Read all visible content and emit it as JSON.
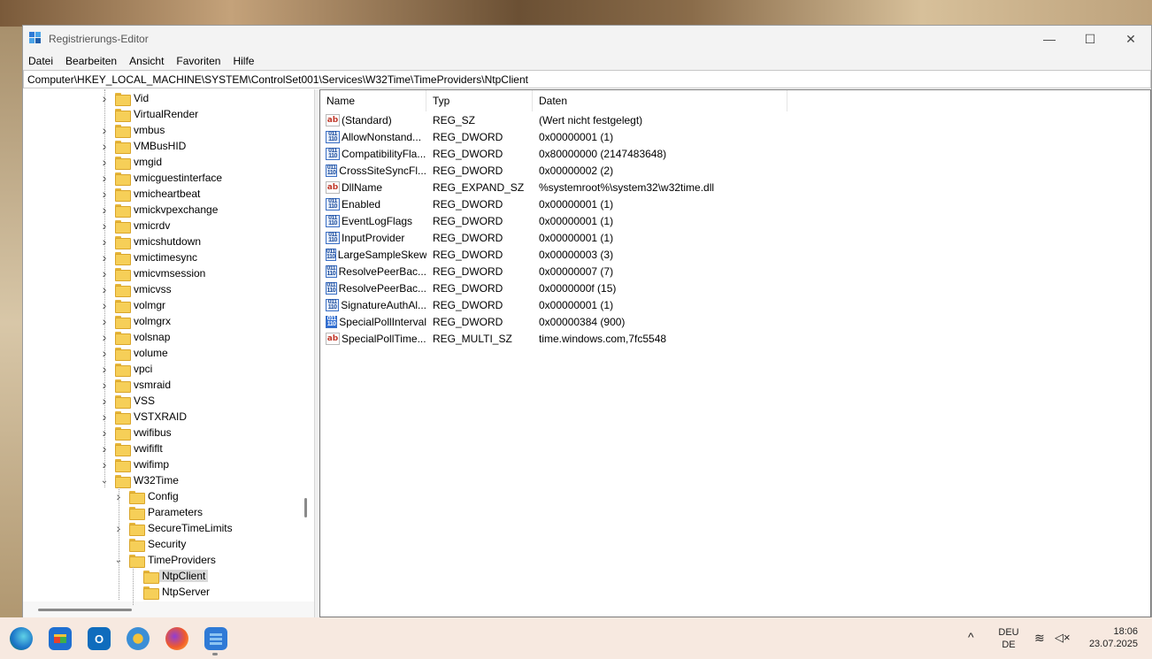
{
  "window": {
    "title": "Registrierungs-Editor",
    "controls": {
      "minimize": "—",
      "maximize": "☐",
      "close": "✕"
    }
  },
  "menu": [
    "Datei",
    "Bearbeiten",
    "Ansicht",
    "Favoriten",
    "Hilfe"
  ],
  "address": "Computer\\HKEY_LOCAL_MACHINE\\SYSTEM\\ControlSet001\\Services\\W32Time\\TimeProviders\\NtpClient",
  "tree": [
    {
      "label": "Vid",
      "expandable": true,
      "level": 0
    },
    {
      "label": "VirtualRender",
      "expandable": false,
      "level": 0
    },
    {
      "label": "vmbus",
      "expandable": true,
      "level": 0
    },
    {
      "label": "VMBusHID",
      "expandable": true,
      "level": 0
    },
    {
      "label": "vmgid",
      "expandable": true,
      "level": 0
    },
    {
      "label": "vmicguestinterface",
      "expandable": true,
      "level": 0
    },
    {
      "label": "vmicheartbeat",
      "expandable": true,
      "level": 0
    },
    {
      "label": "vmickvpexchange",
      "expandable": true,
      "level": 0
    },
    {
      "label": "vmicrdv",
      "expandable": true,
      "level": 0
    },
    {
      "label": "vmicshutdown",
      "expandable": true,
      "level": 0
    },
    {
      "label": "vmictimesync",
      "expandable": true,
      "level": 0
    },
    {
      "label": "vmicvmsession",
      "expandable": true,
      "level": 0
    },
    {
      "label": "vmicvss",
      "expandable": true,
      "level": 0
    },
    {
      "label": "volmgr",
      "expandable": true,
      "level": 0
    },
    {
      "label": "volmgrx",
      "expandable": true,
      "level": 0
    },
    {
      "label": "volsnap",
      "expandable": true,
      "level": 0
    },
    {
      "label": "volume",
      "expandable": true,
      "level": 0
    },
    {
      "label": "vpci",
      "expandable": true,
      "level": 0
    },
    {
      "label": "vsmraid",
      "expandable": true,
      "level": 0
    },
    {
      "label": "VSS",
      "expandable": true,
      "level": 0
    },
    {
      "label": "VSTXRAID",
      "expandable": true,
      "level": 0
    },
    {
      "label": "vwifibus",
      "expandable": true,
      "level": 0
    },
    {
      "label": "vwififlt",
      "expandable": true,
      "level": 0
    },
    {
      "label": "vwifimp",
      "expandable": true,
      "level": 0
    },
    {
      "label": "W32Time",
      "expandable": true,
      "expanded": true,
      "level": 0
    },
    {
      "label": "Config",
      "expandable": true,
      "level": 1
    },
    {
      "label": "Parameters",
      "expandable": false,
      "level": 1
    },
    {
      "label": "SecureTimeLimits",
      "expandable": true,
      "level": 1
    },
    {
      "label": "Security",
      "expandable": false,
      "level": 1
    },
    {
      "label": "TimeProviders",
      "expandable": true,
      "expanded": true,
      "level": 1
    },
    {
      "label": "NtpClient",
      "expandable": false,
      "level": 2,
      "selected": true
    },
    {
      "label": "NtpServer",
      "expandable": false,
      "level": 2
    }
  ],
  "list": {
    "columns": [
      "Name",
      "Typ",
      "Daten"
    ],
    "rows": [
      {
        "icon": "string-value-icon",
        "name": "(Standard)",
        "type": "REG_SZ",
        "data": "(Wert nicht festgelegt)"
      },
      {
        "icon": "binary-value-icon",
        "name": "AllowNonstand...",
        "type": "REG_DWORD",
        "data": "0x00000001 (1)"
      },
      {
        "icon": "binary-value-icon",
        "name": "CompatibilityFla...",
        "type": "REG_DWORD",
        "data": "0x80000000 (2147483648)"
      },
      {
        "icon": "binary-value-icon",
        "name": "CrossSiteSyncFl...",
        "type": "REG_DWORD",
        "data": "0x00000002 (2)"
      },
      {
        "icon": "string-value-icon",
        "name": "DllName",
        "type": "REG_EXPAND_SZ",
        "data": "%systemroot%\\system32\\w32time.dll"
      },
      {
        "icon": "binary-value-icon",
        "name": "Enabled",
        "type": "REG_DWORD",
        "data": "0x00000001 (1)"
      },
      {
        "icon": "binary-value-icon",
        "name": "EventLogFlags",
        "type": "REG_DWORD",
        "data": "0x00000001 (1)"
      },
      {
        "icon": "binary-value-icon",
        "name": "InputProvider",
        "type": "REG_DWORD",
        "data": "0x00000001 (1)"
      },
      {
        "icon": "binary-value-icon",
        "name": "LargeSampleSkew",
        "type": "REG_DWORD",
        "data": "0x00000003 (3)"
      },
      {
        "icon": "binary-value-icon",
        "name": "ResolvePeerBac...",
        "type": "REG_DWORD",
        "data": "0x00000007 (7)"
      },
      {
        "icon": "binary-value-icon",
        "name": "ResolvePeerBac...",
        "type": "REG_DWORD",
        "data": "0x0000000f (15)"
      },
      {
        "icon": "binary-value-icon",
        "name": "SignatureAuthAl...",
        "type": "REG_DWORD",
        "data": "0x00000001 (1)"
      },
      {
        "icon": "binary-value-icon",
        "name": "SpecialPollInterval",
        "type": "REG_DWORD",
        "data": "0x00000384 (900)",
        "highlighted": true
      },
      {
        "icon": "string-value-icon",
        "name": "SpecialPollTime...",
        "type": "REG_MULTI_SZ",
        "data": "time.windows.com,7fc5548"
      }
    ]
  },
  "taskbar": {
    "apps": [
      "edge-icon",
      "store-icon",
      "outlook-icon",
      "settings-icon",
      "firefox-icon",
      "regedit-icon"
    ],
    "tray": {
      "chevron": "^",
      "lang_top": "DEU",
      "lang_bottom": "DE",
      "time": "18:06",
      "date": "23.07.2025"
    }
  },
  "colors": {
    "folder": "#f6cf58",
    "selection": "#d9d9d9",
    "taskbar": "#f7e9e0",
    "accent": "#2f6ed4"
  }
}
